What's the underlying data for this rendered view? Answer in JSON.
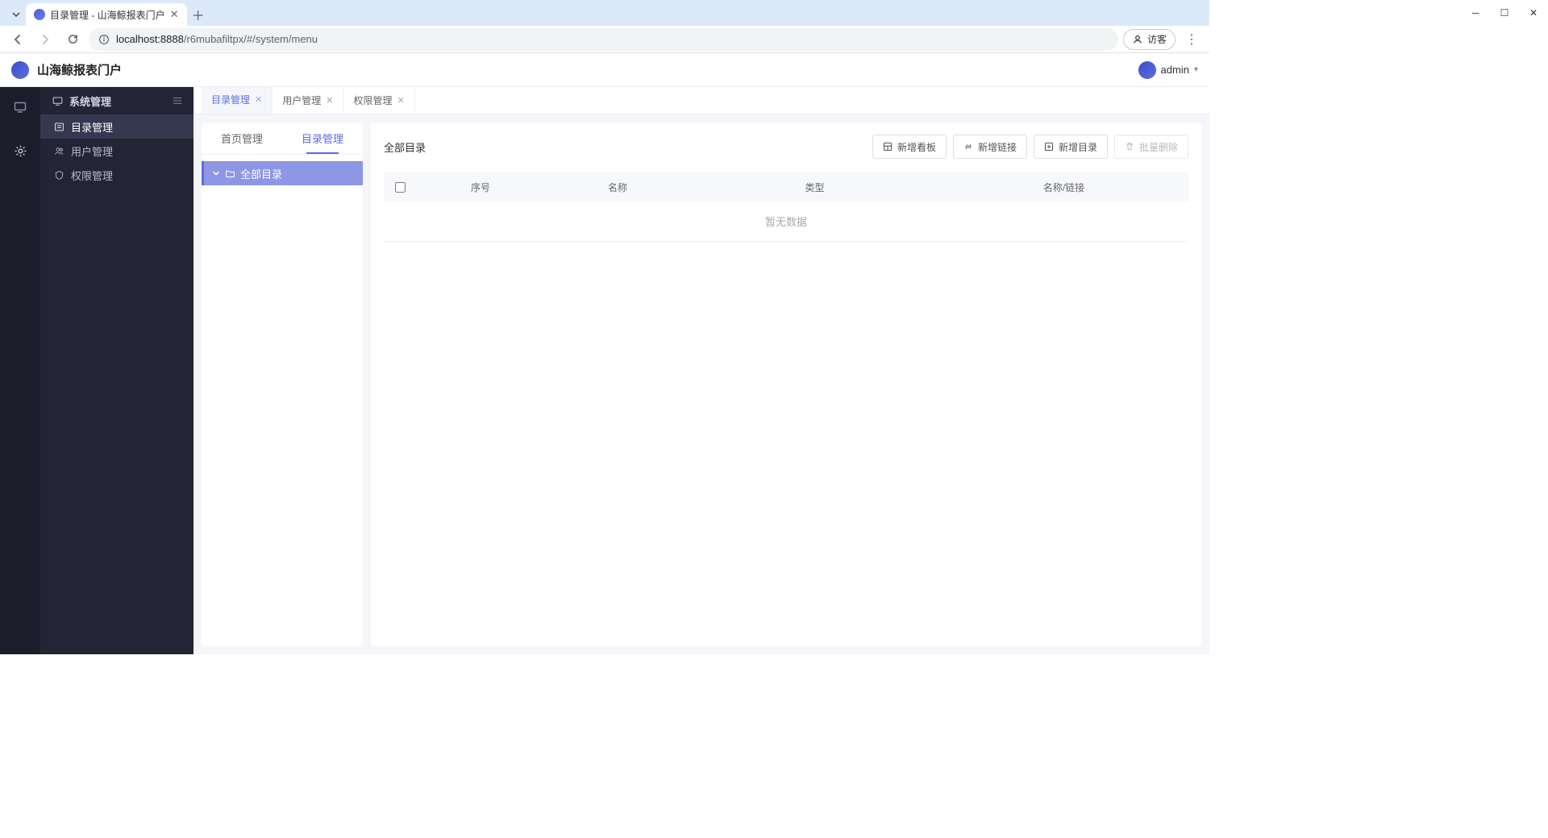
{
  "browser": {
    "tab_title": "目录管理 - 山海鲸报表门户",
    "url_host": "localhost:8888",
    "url_path": "/r6mubafiltpx/#/system/menu",
    "guest_label": "访客"
  },
  "app": {
    "title": "山海鲸报表门户",
    "user": "admin"
  },
  "sidebar": {
    "group": "系统管理",
    "items": [
      {
        "label": "目录管理",
        "icon": "list"
      },
      {
        "label": "用户管理",
        "icon": "users"
      },
      {
        "label": "权限管理",
        "icon": "shield"
      }
    ]
  },
  "page_tabs": [
    {
      "label": "目录管理",
      "active": true
    },
    {
      "label": "用户管理",
      "active": false
    },
    {
      "label": "权限管理",
      "active": false
    }
  ],
  "subtabs": {
    "home": "首页管理",
    "catalog": "目录管理"
  },
  "tree": {
    "root": "全部目录"
  },
  "panel": {
    "title": "全部目录",
    "buttons": {
      "new_board": "新增看板",
      "new_link": "新增链接",
      "new_dir": "新增目录",
      "bulk_delete": "批量删除"
    },
    "columns": {
      "seq": "序号",
      "name": "名称",
      "type": "类型",
      "link": "名称/链接"
    },
    "empty": "暂无数据"
  }
}
